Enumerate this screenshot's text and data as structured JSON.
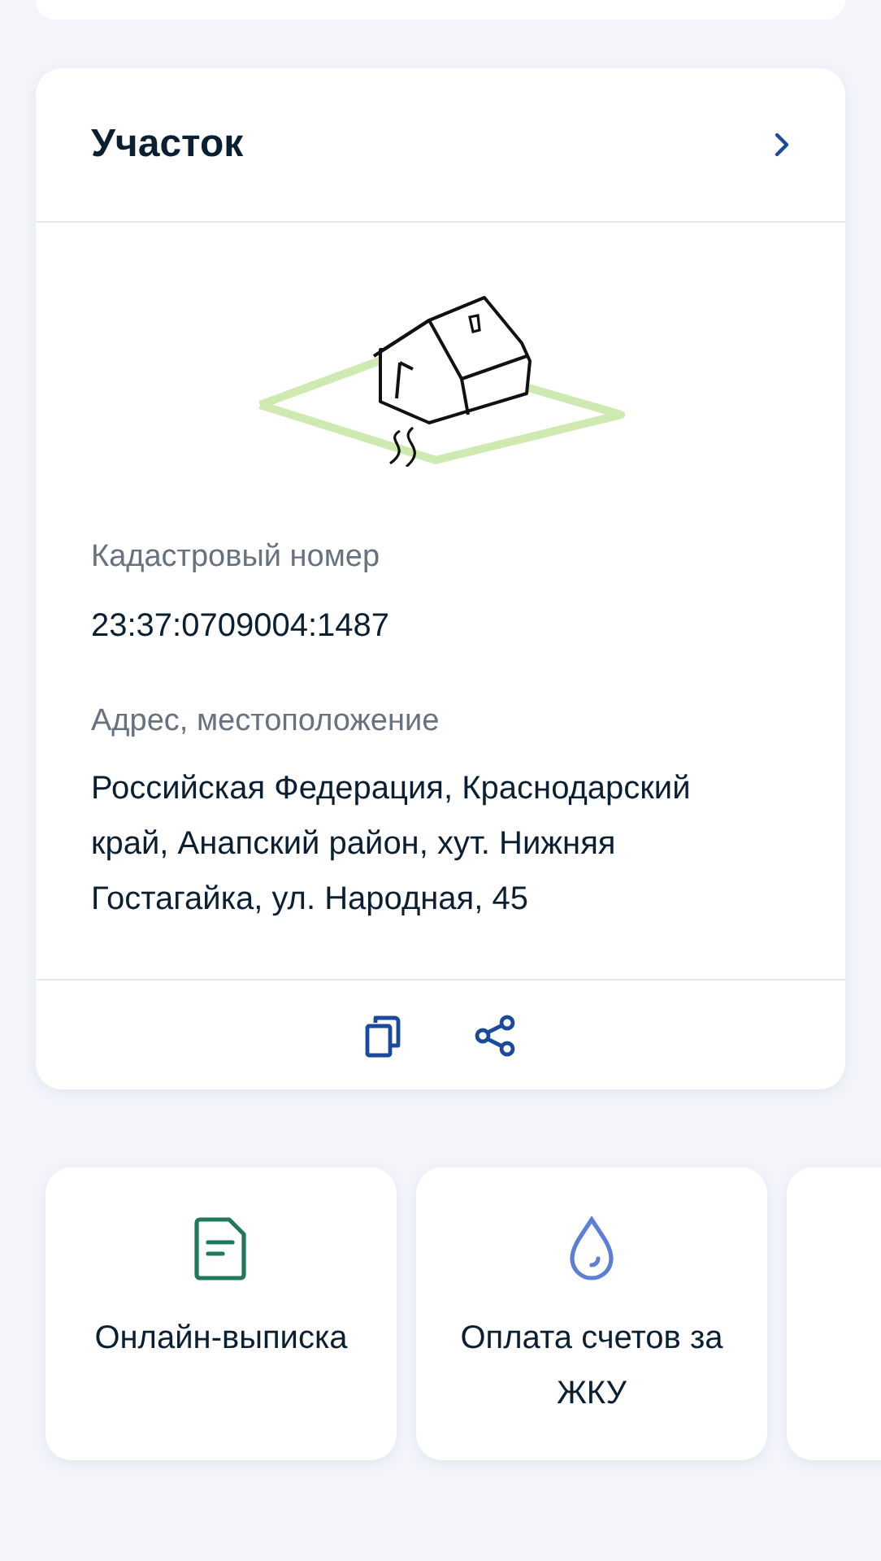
{
  "plot_card": {
    "title": "Участок",
    "fields": [
      {
        "label": "Кадастровый номер",
        "value": "23:37:0709004:1487"
      },
      {
        "label": "Адрес, местоположение",
        "value": "Российская Федерация, Краснодарский край, Анапский район, хут. Нижняя Гостагайка, ул. Народная, 45"
      }
    ]
  },
  "services": [
    {
      "kind": "document",
      "label": "Онлайн-выписка"
    },
    {
      "kind": "water",
      "label": "Оплата счетов за ЖКУ"
    },
    {
      "kind": "hidden"
    }
  ]
}
